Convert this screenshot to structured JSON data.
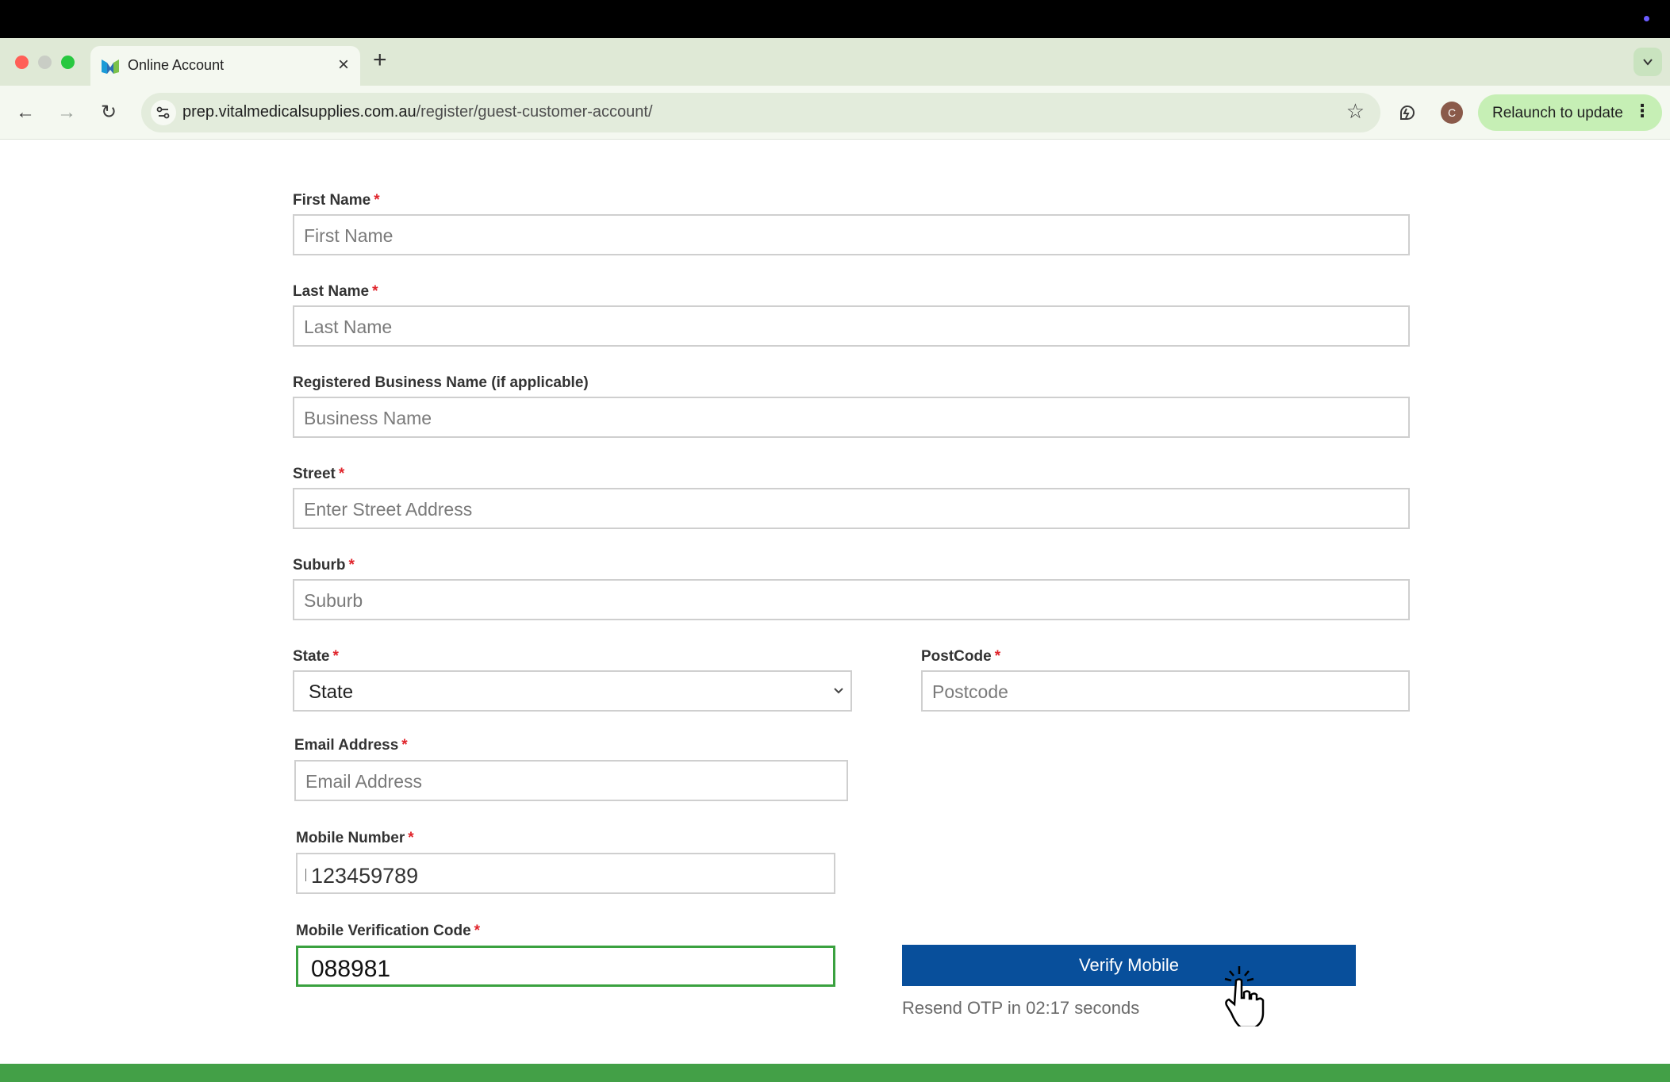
{
  "browser": {
    "tab_title": "Online Account",
    "close_glyph": "×",
    "newtab_glyph": "+",
    "tabmenu_glyph": "⌄",
    "url_host": "prep.vitalmedicalsupplies.com.au",
    "url_path": "/register/guest-customer-account/",
    "avatar_initial": "C",
    "relaunch_label": "Relaunch to update",
    "back_glyph": "←",
    "forward_glyph": "→",
    "reload_glyph": "↻",
    "star_glyph": "☆",
    "kebab_glyph": "⋮"
  },
  "form": {
    "first_name": {
      "label": "First Name",
      "required": "*",
      "placeholder": "First Name"
    },
    "last_name": {
      "label": "Last Name",
      "required": "*",
      "placeholder": "Last Name"
    },
    "business_name": {
      "label": "Registered Business Name (if applicable)",
      "placeholder": "Business Name"
    },
    "street": {
      "label": "Street",
      "required": "*",
      "placeholder": "Enter Street Address"
    },
    "suburb": {
      "label": "Suburb",
      "required": "*",
      "placeholder": "Suburb"
    },
    "state": {
      "label": "State",
      "required": "*",
      "selected": "State"
    },
    "postcode": {
      "label": "PostCode",
      "required": "*",
      "placeholder": "Postcode"
    },
    "email": {
      "label": "Email Address",
      "required": "*",
      "placeholder": "Email Address"
    },
    "mobile": {
      "label": "Mobile Number",
      "required": "*",
      "value": "123459789"
    },
    "verification": {
      "label": "Mobile Verification Code",
      "required": "*",
      "value": "088981"
    },
    "verify_button": "Verify Mobile",
    "resend_text": "Resend OTP in 02:17 seconds"
  },
  "colors": {
    "accent_green": "#43a047",
    "verify_blue": "#084f9b",
    "required_red": "#e0242b"
  },
  "icons": [
    "favicon-icon",
    "back-icon",
    "forward-icon",
    "reload-icon",
    "site-info-icon",
    "star-icon",
    "extension-icon",
    "kebab-icon",
    "chevron-down-icon",
    "hand-pointer-icon"
  ]
}
